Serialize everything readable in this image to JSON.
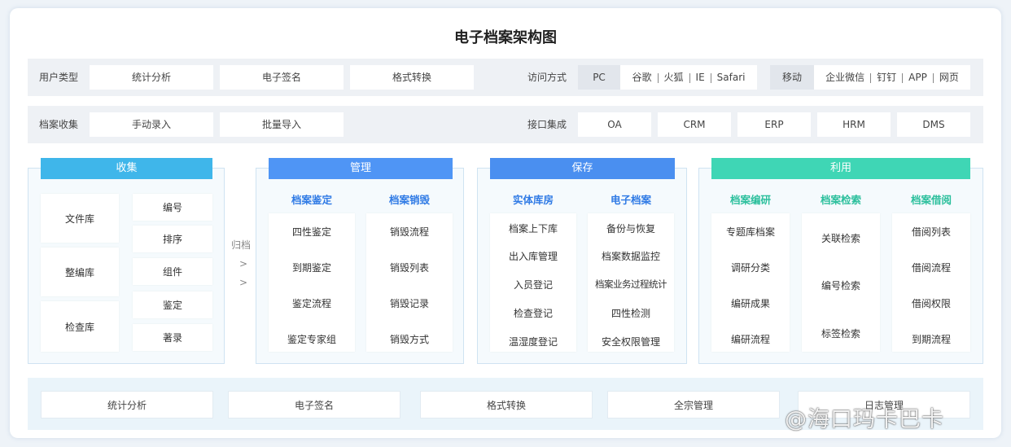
{
  "title": "电子档案架构图",
  "row1": {
    "label": "用户类型",
    "boxes": [
      "统计分析",
      "电子签名",
      "格式转换"
    ],
    "access_label": "访问方式",
    "pc_label": "PC",
    "pc_items": [
      "谷歌",
      "火狐",
      "IE",
      "Safari"
    ],
    "mobile_label": "移动",
    "mobile_items": [
      "企业微信",
      "钉钉",
      "APP",
      "网页"
    ]
  },
  "row2": {
    "label": "档案收集",
    "boxes": [
      "手动录入",
      "批量导入"
    ],
    "api_label": "接口集成",
    "api_items": [
      "OA",
      "CRM",
      "ERP",
      "HRM",
      "DMS"
    ]
  },
  "collect": {
    "header": "收集",
    "left": [
      "文件库",
      "整编库",
      "检查库"
    ],
    "right": [
      "编号",
      "排序",
      "组件",
      "鉴定",
      "著录"
    ]
  },
  "archive_arrow": {
    "label": "归档",
    "arrows": [
      ">",
      ">"
    ]
  },
  "manage": {
    "header": "管理",
    "col1_title": "档案鉴定",
    "col1": [
      "四性鉴定",
      "到期鉴定",
      "鉴定流程",
      "鉴定专家组"
    ],
    "col2_title": "档案销毁",
    "col2": [
      "销毁流程",
      "销毁列表",
      "销毁记录",
      "销毁方式"
    ]
  },
  "preserve": {
    "header": "保存",
    "col1_title": "实体库房",
    "col1": [
      "档案上下库",
      "出入库管理",
      "入员登记",
      "检查登记",
      "温湿度登记"
    ],
    "col2_title": "电子档案",
    "col2": [
      "备份与恢复",
      "档案数据监控",
      "档案业务过程统计",
      "四性检测",
      "安全权限管理"
    ]
  },
  "use": {
    "header": "利用",
    "col1_title": "档案编研",
    "col1": [
      "专题库档案",
      "调研分类",
      "编研成果",
      "编研流程"
    ],
    "col2_title": "档案检索",
    "col2": [
      "关联检索",
      "编号检索",
      "标签检索"
    ],
    "col3_title": "档案借阅",
    "col3": [
      "借阅列表",
      "借阅流程",
      "借阅权限",
      "到期流程"
    ]
  },
  "bottom": [
    "统计分析",
    "电子签名",
    "格式转换",
    "全宗管理",
    "日志管理"
  ],
  "watermark": "@海口玛卡巴卡",
  "colors": {
    "collect": "#3fb6ea",
    "manage": "#4f95f5",
    "preserve": "#4a8ff0",
    "use": "#3fd6b5",
    "sub_blue": "#2f7ae5",
    "sub_teal": "#2bbf9c"
  }
}
